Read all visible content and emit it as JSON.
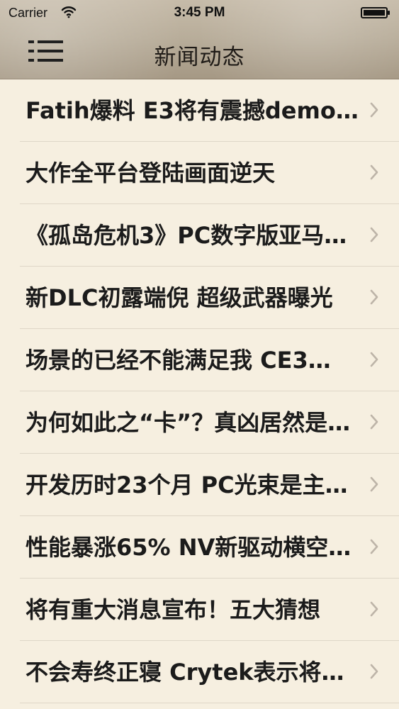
{
  "status_bar": {
    "carrier": "Carrier",
    "time": "3:45 PM",
    "icons": [
      "wifi-icon",
      "battery-icon"
    ]
  },
  "nav_bar": {
    "title": "新闻动态",
    "menu_icon": "menu-icon"
  },
  "news": {
    "items": [
      {
        "title": "Fatih爆料 E3将有震撼demo…"
      },
      {
        "title": "大作全平台登陆画面逆天"
      },
      {
        "title": "《孤岛危机3》PC数字版亚马…"
      },
      {
        "title": "新DLC初露端倪 超级武器曝光"
      },
      {
        "title": "场景的已经不能满足我 CE3…"
      },
      {
        "title": "为何如此之“卡”？真凶居然是…"
      },
      {
        "title": "开发历时23个月 PC光束是主…"
      },
      {
        "title": "性能暴涨65% NV新驱动横空…"
      },
      {
        "title": "将有重大消息宣布！五大猜想"
      },
      {
        "title": "不会寿终正寝 Crytek表示将…"
      }
    ],
    "chevron_icon": "chevron-right-icon"
  },
  "colors": {
    "background": "#f6efe0",
    "header": "#b8ad9a",
    "separator": "#ded6c7",
    "chevron": "#bdb4a8"
  }
}
